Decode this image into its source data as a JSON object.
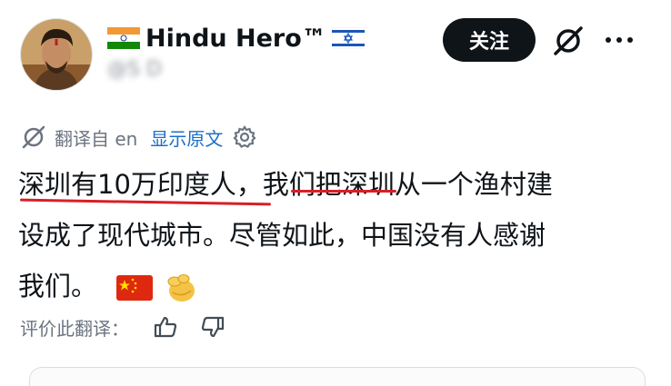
{
  "post": {
    "author": {
      "display_name": "Hindu Hero™",
      "handle": "@S     D     ",
      "prefix_flag_icon": "india-flag-icon",
      "suffix_flag_icon": "israel-flag-icon"
    },
    "follow_label": "关注",
    "translation": {
      "label": "翻译自 en",
      "show_original_label": "显示原文"
    },
    "body_lines": [
      "深圳有10万印度人，我们把深圳从一个渔村建",
      "设成了现代城市。尽管如此，中国没有人感谢",
      "我们。"
    ],
    "emojis": [
      "china-flag-icon",
      "pinching-hand-icon"
    ],
    "rate_label": "评价此翻译："
  },
  "colors": {
    "text": "#0f1419",
    "muted": "#6b7480",
    "link": "#1d6fc9",
    "underline": "#d81f26",
    "button_bg": "#0f1419"
  }
}
